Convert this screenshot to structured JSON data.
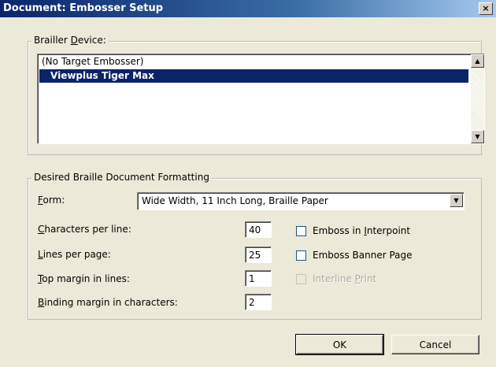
{
  "window": {
    "title": "Document: Embosser Setup",
    "close_glyph": "×"
  },
  "brailler_device": {
    "legend_prefix": "Brailler ",
    "legend_mnemonic": "D",
    "legend_suffix": "evice:",
    "items": [
      {
        "label": "(No Target Embosser)",
        "selected": false
      },
      {
        "label": "Viewplus Tiger Max",
        "selected": true
      }
    ]
  },
  "formatting": {
    "legend": "Desired Braille Document Formatting",
    "form": {
      "mnemonic": "F",
      "rest": "orm:",
      "value": "Wide Width, 11 Inch Long, Braille Paper"
    },
    "chars_per_line": {
      "mnemonic": "C",
      "rest": "haracters per line:",
      "value": "40"
    },
    "lines_per_page": {
      "mnemonic": "L",
      "rest": "ines per page:",
      "value": "25"
    },
    "top_margin": {
      "mnemonic": "T",
      "rest": "op margin in lines:",
      "value": "1"
    },
    "binding_margin": {
      "mnemonic": "B",
      "rest": "inding margin in characters:",
      "value": "2"
    },
    "emboss_interpoint": {
      "prefix": "Emboss in ",
      "mnemonic": "I",
      "suffix": "nterpoint",
      "checked": false
    },
    "emboss_banner": {
      "prefix": "Emboss Banner Page",
      "checked": false
    },
    "interline_print": {
      "prefix": "Interline ",
      "mnemonic": "P",
      "suffix": "rint",
      "checked": false,
      "enabled": false
    }
  },
  "buttons": {
    "ok": "OK",
    "cancel": "Cancel"
  }
}
